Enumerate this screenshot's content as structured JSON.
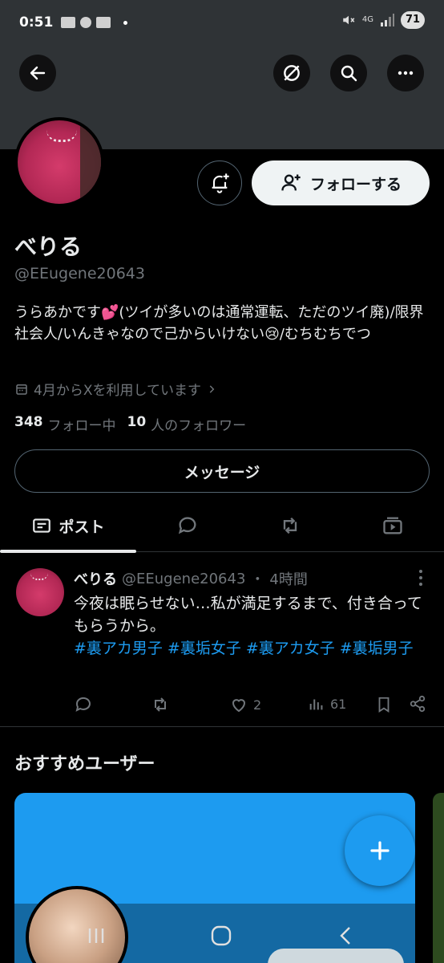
{
  "status_bar": {
    "time": "0:51",
    "network": "4G",
    "battery": "71"
  },
  "header": {
    "back_icon": "back-arrow-icon",
    "translate_icon": "slashed-circle-icon",
    "search_icon": "search-icon",
    "more_icon": "more-dots-icon"
  },
  "profile": {
    "display_name": "べりる",
    "handle": "@EEugene20643",
    "bio": "うらあかです💕(ツイが多いのは通常運転、ただのツイ廃)/限界社会人/いんきゃなので己からいけない😢/むちむちでつ",
    "joined": "4月からXを利用しています",
    "following_count": "348",
    "following_label": "フォロー中",
    "followers_count": "10",
    "followers_label": "人のフォロワー",
    "follow_button": "フォローする",
    "message_button": "メッセージ"
  },
  "tabs": {
    "posts_label": "ポスト",
    "icons": [
      "post-icon",
      "reply-icon",
      "repost-icon",
      "media-icon"
    ]
  },
  "post": {
    "name": "べりる",
    "handle": "@EEugene20643",
    "separator": "・",
    "time": "4時間",
    "text": "今夜は眠らせない…私が満足するまで、付き合ってもらうから。",
    "hashtags": [
      "#裏アカ男子",
      "#裏垢女子",
      "#裏アカ女子",
      "#裏垢男子"
    ],
    "likes": "2",
    "views": "61"
  },
  "recommendations": {
    "title": "おすすめユーザー"
  },
  "colors": {
    "accent": "#1d9bf0",
    "background": "#000000",
    "text": "#e7e9ea",
    "muted": "#71767b"
  }
}
